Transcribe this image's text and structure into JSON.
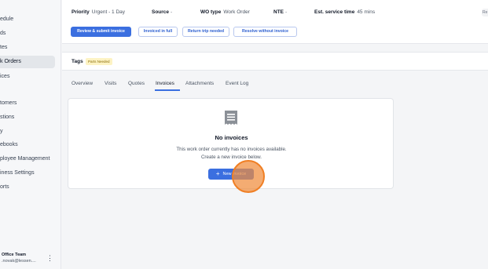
{
  "sidebar": {
    "items": [
      {
        "label": "edule"
      },
      {
        "label": "ds"
      },
      {
        "label": "tes"
      },
      {
        "label": "k Orders"
      },
      {
        "label": "ices"
      },
      {
        "label": "tomers"
      },
      {
        "label": "stions"
      },
      {
        "label": "y"
      },
      {
        "label": "ebooks"
      },
      {
        "label": "ployee Management"
      },
      {
        "label": "iness Settings"
      },
      {
        "label": "orts"
      }
    ],
    "footer": {
      "team": "Office Team",
      "email": ".novak@lessen....",
      "menu_glyph": "⋮"
    }
  },
  "header": {
    "priority_label": "Priority",
    "priority_value": "Urgent - 1 Day",
    "source_label": "Source",
    "source_value": "-",
    "wo_type_label": "WO type",
    "wo_type_value": "Work Order",
    "nte_label": "NTE",
    "nte_value": "-",
    "est_label": "Est. service time",
    "est_value": "45 mins",
    "right_badge": "Re"
  },
  "actions": {
    "review": "Review & submit invoice",
    "invoiced_full": "Invoiced in full",
    "return_trip": "Return trip needed",
    "resolve": "Resolve without invoice"
  },
  "tags": {
    "label": "Tags",
    "items": [
      "Parts Needed"
    ]
  },
  "tabs": [
    "Overview",
    "Visits",
    "Quotes",
    "Invoices",
    "Attachments",
    "Event Log"
  ],
  "active_tab": "Invoices",
  "empty_state": {
    "title": "No invoices",
    "line1": "This work order currently has no invoices available.",
    "line2": "Create a new invoice below.",
    "button": "New invoice",
    "button_icon": "+"
  },
  "colors": {
    "accent": "#3b6fe0",
    "click_marker": "#f07f24",
    "tag_bg": "#fdf3c4"
  }
}
